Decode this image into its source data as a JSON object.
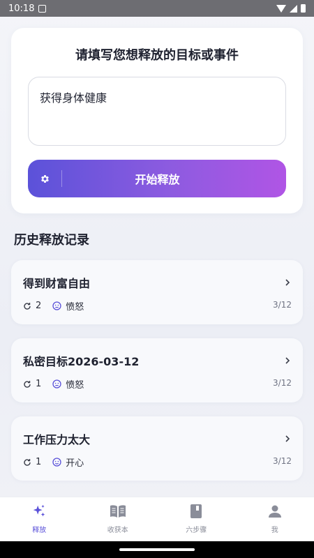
{
  "status_bar": {
    "time": "10:18"
  },
  "release_form": {
    "heading": "请填写您想释放的目标或事件",
    "input_value": "获得身体健康",
    "start_label": "开始释放"
  },
  "history": {
    "title": "历史释放记录",
    "records": [
      {
        "title": "得到财富自由",
        "count": "2",
        "emotion": "愤怒",
        "date": "3/12"
      },
      {
        "title": "私密目标2026-03-12",
        "count": "1",
        "emotion": "愤怒",
        "date": "3/12"
      },
      {
        "title": "工作压力太大",
        "count": "1",
        "emotion": "开心",
        "date": "3/12"
      }
    ]
  },
  "nav": {
    "items": [
      {
        "label": "释放",
        "icon": "sparkle-icon",
        "active": true
      },
      {
        "label": "收获本",
        "icon": "book-open-icon",
        "active": false
      },
      {
        "label": "六步骤",
        "icon": "book-icon",
        "active": false
      },
      {
        "label": "我",
        "icon": "person-icon",
        "active": false
      }
    ]
  },
  "colors": {
    "accent": "#5b52d9",
    "gradient_end": "#b055e5",
    "text": "#1f2230",
    "muted": "#8a8d99"
  }
}
